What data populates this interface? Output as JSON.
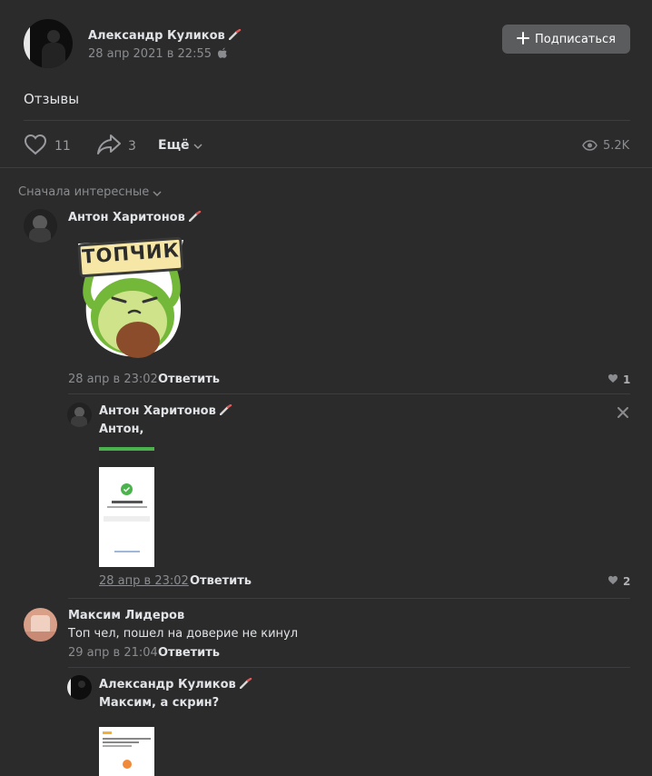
{
  "post": {
    "author": "Александр Куликов",
    "date": "28 апр 2021 в 22:55",
    "subscribe_label": "Подписаться",
    "text": "Отзывы",
    "likes": "11",
    "shares": "3",
    "more_label": "Ещё",
    "views": "5.2K"
  },
  "sort_label": "Сначала интересные",
  "sticker_text": "ТОПЧИК",
  "comments": [
    {
      "author": "Антон Харитонов",
      "date": "28 апр в 23:02",
      "reply_label": "Ответить",
      "likes": "1",
      "reply": {
        "author": "Антон Харитонов",
        "text": "Антон,",
        "date": "28 апр в 23:02",
        "reply_label": "Ответить",
        "likes": "2"
      }
    },
    {
      "author": "Максим Лидеров",
      "text": "Топ чел, пошел на доверие не кинул",
      "date": "29 апр в 21:04",
      "reply_label": "Ответить",
      "reply": {
        "author": "Александр Куликов",
        "text": "Максим, а скрин?"
      }
    }
  ]
}
